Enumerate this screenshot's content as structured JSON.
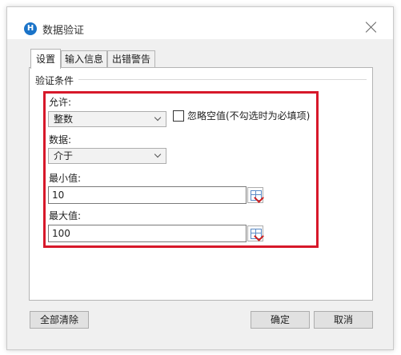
{
  "window": {
    "title": "数据验证",
    "app_icon_text": "H"
  },
  "tabs": [
    {
      "label": "设置",
      "active": true
    },
    {
      "label": "输入信息",
      "active": false
    },
    {
      "label": "出错警告",
      "active": false
    }
  ],
  "settings": {
    "group_label": "验证条件",
    "allow": {
      "label": "允许:",
      "selected": "整数"
    },
    "ignore_blank": {
      "label": "忽略空值(不勾选时为必填项)",
      "checked": false
    },
    "data": {
      "label": "数据:",
      "selected": "介于"
    },
    "minimum": {
      "label": "最小值:",
      "value": "10"
    },
    "maximum": {
      "label": "最大值:",
      "value": "100"
    }
  },
  "footer": {
    "clear_all": "全部清除",
    "ok": "确定",
    "cancel": "取消"
  },
  "colors": {
    "highlight": "#d7182a",
    "app_icon": "#1a73c8"
  },
  "icons": {
    "close": "close-icon",
    "app": "app-logo-icon",
    "range_picker": "range-picker-icon"
  }
}
